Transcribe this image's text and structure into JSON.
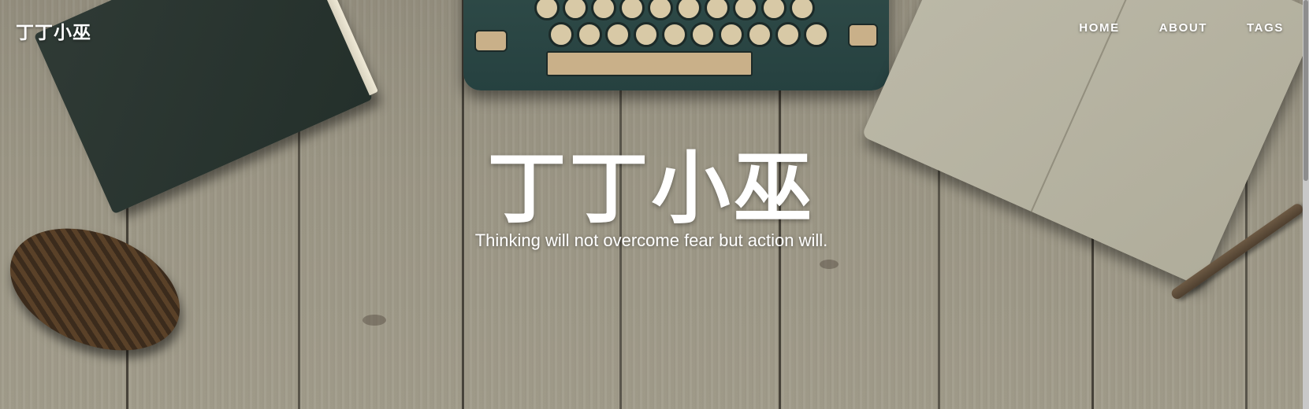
{
  "navbar": {
    "brand": "丁丁小巫",
    "links": [
      {
        "label": "HOME"
      },
      {
        "label": "ABOUT"
      },
      {
        "label": "TAGS"
      }
    ]
  },
  "header": {
    "title": "丁丁小巫",
    "subtitle": "Thinking will not overcome fear but action will."
  },
  "colors": {
    "text": "#ffffff",
    "wood": "#9c9786",
    "typewriter": "#2f4b48",
    "book": "#2f3a35"
  }
}
